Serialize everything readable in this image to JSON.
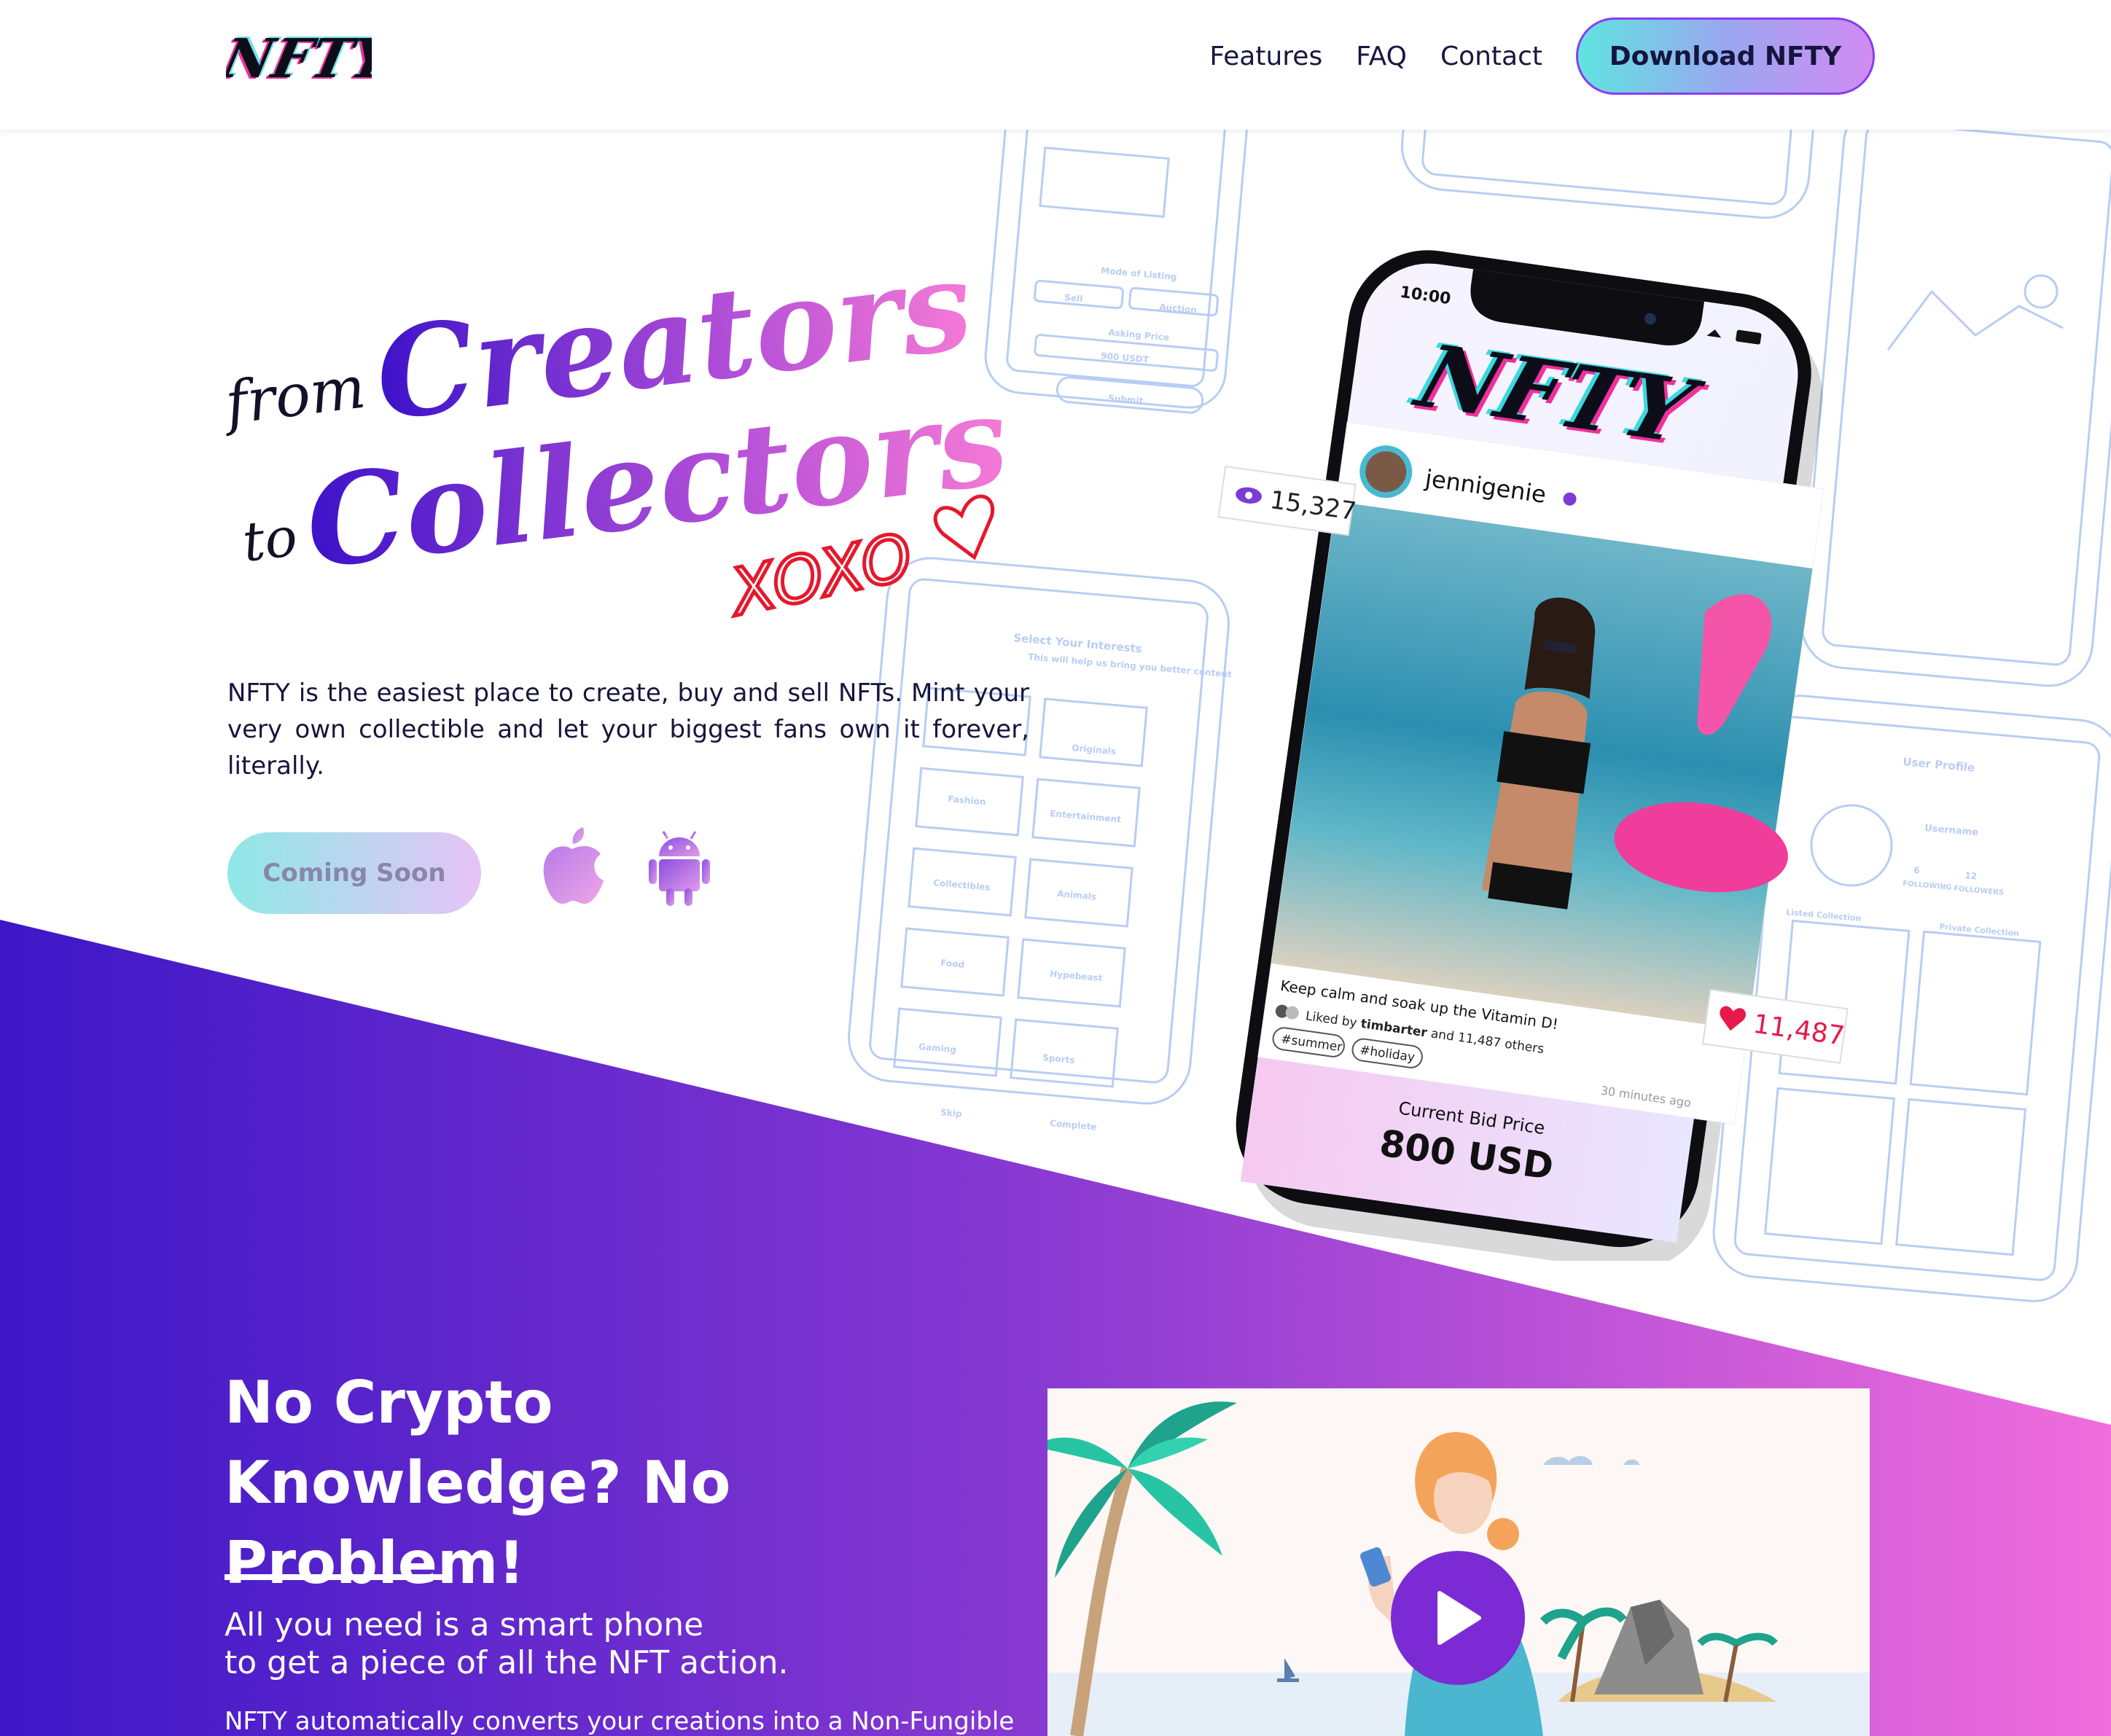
{
  "header": {
    "logo_text": "NFTY",
    "nav": [
      {
        "label": "Features"
      },
      {
        "label": "FAQ"
      },
      {
        "label": "Contact"
      }
    ],
    "download_label": "Download NFTY"
  },
  "hero": {
    "from": "from",
    "creators": "Creators",
    "to": "to",
    "collectors": "Collectors",
    "xoxo": "XOXO",
    "description": "NFTY is the easiest place to create, buy and sell NFTs. Mint your very own collectible and let your biggest fans own it forever, literally.",
    "coming_soon": "Coming Soon"
  },
  "phone": {
    "time": "10:00",
    "app_logo": "NFTY",
    "views": "15,327",
    "username": "jennigenie",
    "caption": "Keep calm and soak up the Vitamin D!",
    "liked_by_prefix": "Liked by",
    "liked_by_user": "timbarter",
    "liked_by_suffix": "and 11,487 others",
    "tags": [
      "#summer",
      "#holiday"
    ],
    "time_ago": "30 minutes ago",
    "likes": "11,487",
    "bid_label": "Current Bid Price",
    "bid_value": "800 USD"
  },
  "wireframes": {
    "interests_title": "Select Your Interests",
    "interests_sub": "This will help us bring you better content",
    "categories": [
      "Originals",
      "Fashion",
      "Entertainment",
      "Collectibles",
      "Animals",
      "Food",
      "Hypebeast",
      "Gaming",
      "Sports"
    ],
    "skip": "Skip",
    "complete": "Complete",
    "profile_title": "User Profile",
    "profile_username": "Username",
    "following": "FOLLOWING",
    "followers": "FOLLOWERS",
    "following_count": "6",
    "followers_count": "12",
    "listed_collection": "Listed Collection",
    "private_collection": "Private Collection",
    "mode_of_listing": "Mode of Listing",
    "sell": "Sell",
    "auction": "Auction",
    "asking_price": "Asking Price",
    "price_value": "900 USDT",
    "submit": "Submit"
  },
  "section2": {
    "title_line1": "No Crypto",
    "title_line2": "Knowledge? No Problem!",
    "sub_line1": "All you need is a smart phone",
    "sub_line2": "to get a piece of all the NFT action.",
    "body": "NFTY automatically converts your creations into a Non-Fungible"
  },
  "colors": {
    "accent_purple": "#7c2bd4",
    "band_start": "#3d17c7",
    "band_end": "#f06ddc",
    "cyan": "#5fe4e0",
    "heart_red": "#e8194a"
  }
}
